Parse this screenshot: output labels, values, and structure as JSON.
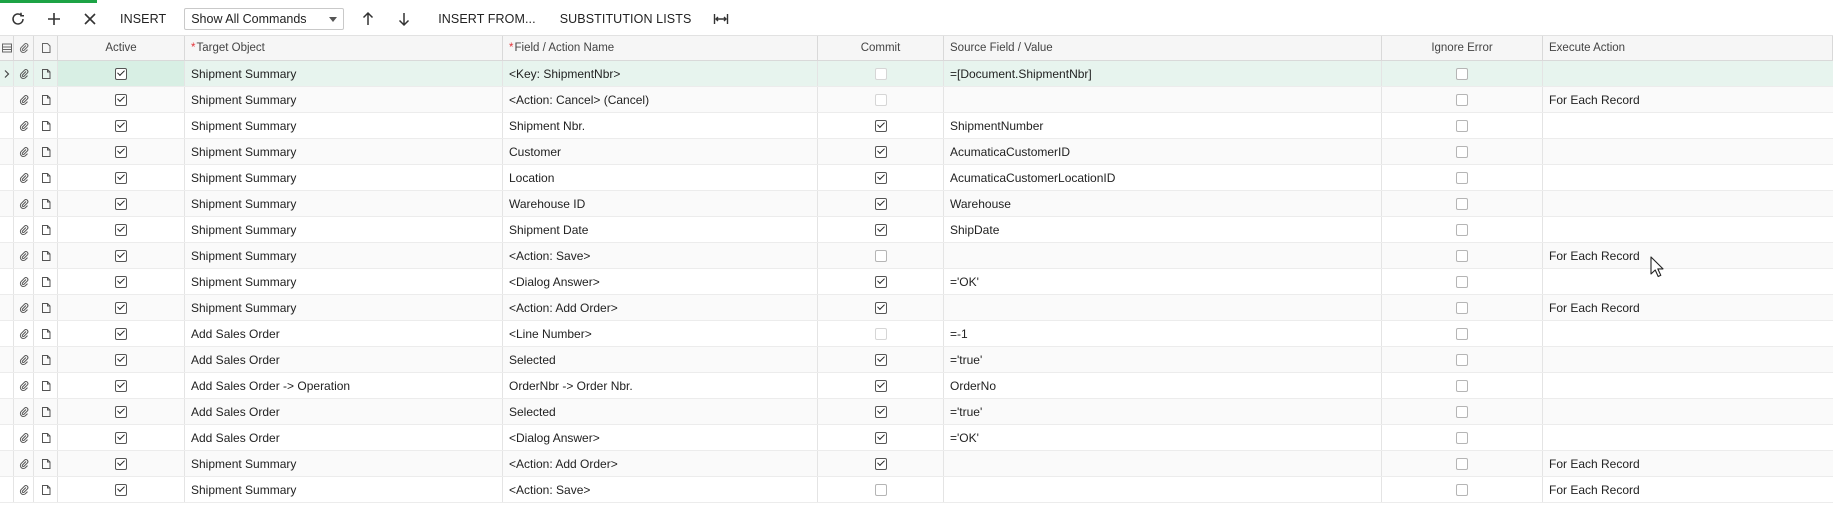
{
  "colors": {
    "accent": "#1ca345",
    "row_highlight": "#e7f4ee"
  },
  "toolbar": {
    "refresh_icon": "refresh-icon",
    "add_icon": "plus-icon",
    "delete_icon": "close-icon",
    "insert_label": "INSERT",
    "filter_select_value": "Show All Commands",
    "move_up_icon": "arrow-up-icon",
    "move_down_icon": "arrow-down-icon",
    "insert_from_label": "INSERT FROM...",
    "substitution_lists_label": "SUBSTITUTION LISTS",
    "fit_columns_icon": "fit-columns-icon"
  },
  "grid": {
    "headers": {
      "active": "Active",
      "target_object": "Target Object",
      "field_action": "Field / Action Name",
      "commit": "Commit",
      "source_field": "Source Field / Value",
      "ignore_error": "Ignore Error",
      "execute_action": "Execute Action",
      "required_mark": "*"
    },
    "rows": [
      {
        "active": true,
        "target": "Shipment Summary",
        "field": "<Key: ShipmentNbr>",
        "commit": false,
        "commit_disabled": true,
        "source": "=[Document.ShipmentNbr]",
        "ignore": false,
        "exec": ""
      },
      {
        "active": true,
        "target": "Shipment Summary",
        "field": "<Action: Cancel> (Cancel)",
        "commit": false,
        "commit_disabled": true,
        "source": "",
        "ignore": false,
        "exec": "For Each Record"
      },
      {
        "active": true,
        "target": "Shipment Summary",
        "field": "Shipment Nbr.",
        "commit": true,
        "commit_disabled": false,
        "source": "ShipmentNumber",
        "ignore": false,
        "exec": ""
      },
      {
        "active": true,
        "target": "Shipment Summary",
        "field": "Customer",
        "commit": true,
        "commit_disabled": false,
        "source": "AcumaticaCustomerID",
        "ignore": false,
        "exec": ""
      },
      {
        "active": true,
        "target": "Shipment Summary",
        "field": "Location",
        "commit": true,
        "commit_disabled": false,
        "source": "AcumaticaCustomerLocationID",
        "ignore": false,
        "exec": ""
      },
      {
        "active": true,
        "target": "Shipment Summary",
        "field": "Warehouse ID",
        "commit": true,
        "commit_disabled": false,
        "source": "Warehouse",
        "ignore": false,
        "exec": ""
      },
      {
        "active": true,
        "target": "Shipment Summary",
        "field": "Shipment Date",
        "commit": true,
        "commit_disabled": false,
        "source": "ShipDate",
        "ignore": false,
        "exec": ""
      },
      {
        "active": true,
        "target": "Shipment Summary",
        "field": "<Action: Save>",
        "commit": false,
        "commit_disabled": false,
        "source": "",
        "ignore": false,
        "exec": "For Each Record"
      },
      {
        "active": true,
        "target": "Shipment Summary",
        "field": "<Dialog Answer>",
        "commit": true,
        "commit_disabled": false,
        "source": "='OK'",
        "ignore": false,
        "exec": ""
      },
      {
        "active": true,
        "target": "Shipment Summary",
        "field": "<Action: Add Order>",
        "commit": true,
        "commit_disabled": false,
        "source": "",
        "ignore": false,
        "exec": "For Each Record"
      },
      {
        "active": true,
        "target": "Add Sales Order",
        "field": "<Line Number>",
        "commit": false,
        "commit_disabled": true,
        "source": "=-1",
        "ignore": false,
        "exec": ""
      },
      {
        "active": true,
        "target": "Add Sales Order",
        "field": "Selected",
        "commit": true,
        "commit_disabled": false,
        "source": "='true'",
        "ignore": false,
        "exec": ""
      },
      {
        "active": true,
        "target": "Add Sales Order -> Operation",
        "field": "OrderNbr -> Order Nbr.",
        "commit": true,
        "commit_disabled": false,
        "source": "OrderNo",
        "ignore": false,
        "exec": ""
      },
      {
        "active": true,
        "target": "Add Sales Order",
        "field": "Selected",
        "commit": true,
        "commit_disabled": false,
        "source": "='true'",
        "ignore": false,
        "exec": ""
      },
      {
        "active": true,
        "target": "Add Sales Order",
        "field": "<Dialog Answer>",
        "commit": true,
        "commit_disabled": false,
        "source": "='OK'",
        "ignore": false,
        "exec": ""
      },
      {
        "active": true,
        "target": "Shipment Summary",
        "field": "<Action: Add Order>",
        "commit": true,
        "commit_disabled": false,
        "source": "",
        "ignore": false,
        "exec": "For Each Record"
      },
      {
        "active": true,
        "target": "Shipment Summary",
        "field": "<Action: Save>",
        "commit": false,
        "commit_disabled": false,
        "source": "",
        "ignore": false,
        "exec": "For Each Record"
      }
    ]
  }
}
